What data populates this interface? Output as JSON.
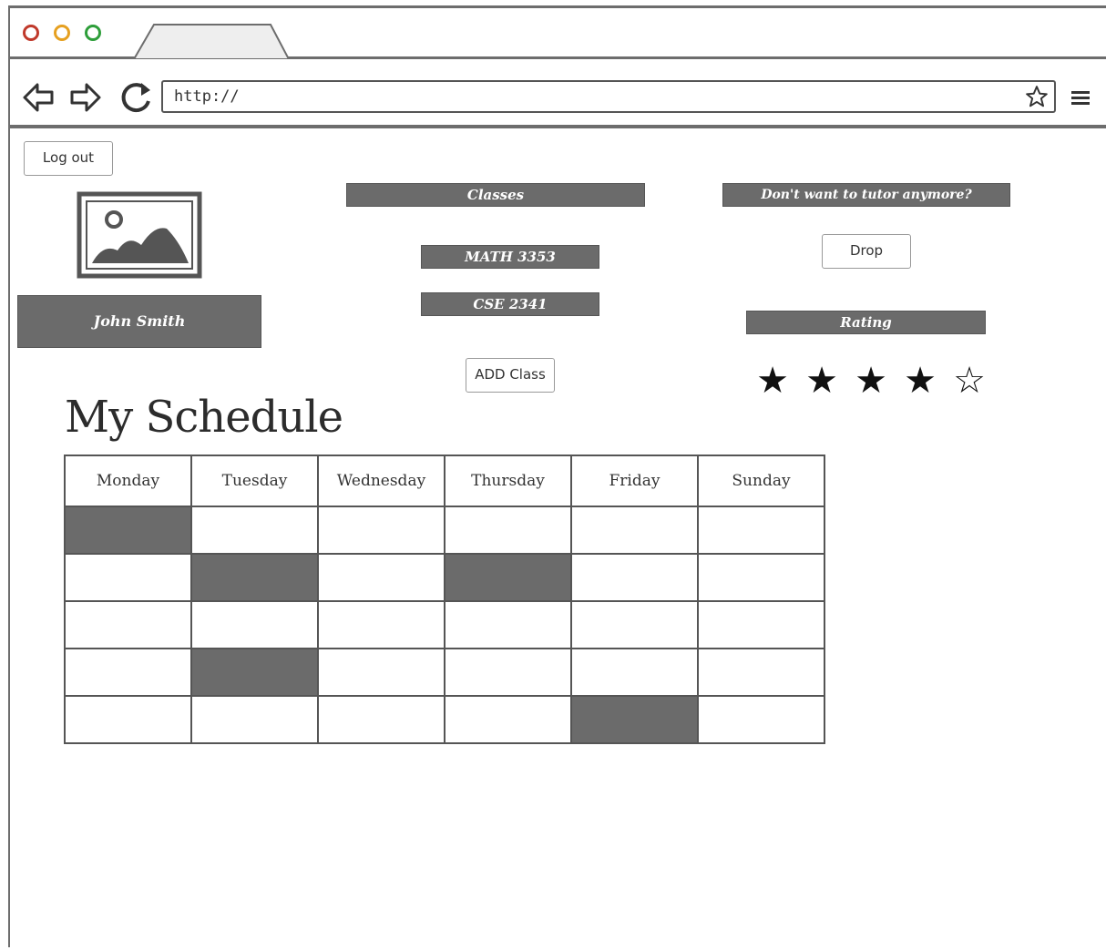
{
  "browser": {
    "url": "http://"
  },
  "profile": {
    "logout_label": "Log out",
    "name": "John Smith"
  },
  "classes": {
    "header": "Classes",
    "items": [
      "MATH 3353",
      "CSE 2341"
    ],
    "add_label": "ADD Class"
  },
  "drop": {
    "header": "Don't want to tutor anymore?",
    "drop_label": "Drop"
  },
  "rating": {
    "header": "Rating",
    "value": 4,
    "max": 5
  },
  "schedule": {
    "title": "My Schedule",
    "days": [
      "Monday",
      "Tuesday",
      "Wednesday",
      "Thursday",
      "Friday",
      "Sunday"
    ],
    "filled": [
      [
        true,
        false,
        false,
        false,
        false,
        false
      ],
      [
        false,
        true,
        false,
        true,
        false,
        false
      ],
      [
        false,
        false,
        false,
        false,
        false,
        false
      ],
      [
        false,
        true,
        false,
        false,
        false,
        false
      ],
      [
        false,
        false,
        false,
        false,
        true,
        false
      ]
    ]
  },
  "colors": {
    "frame": "#6d6d6d",
    "block_fill": "#6b6b6b",
    "traffic_red": "#c0392b",
    "traffic_yellow": "#e6a020",
    "traffic_green": "#2e9e3a"
  }
}
